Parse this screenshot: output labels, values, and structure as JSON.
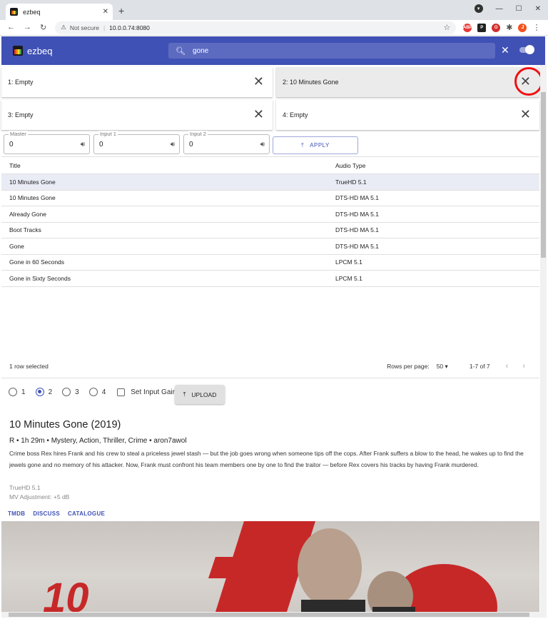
{
  "browser": {
    "tab_title": "ezbeq",
    "security": "Not secure",
    "url": "10.0.0.74:8080",
    "profile_initial": "J"
  },
  "app": {
    "title": "ezbeq",
    "search_value": "gone"
  },
  "slots": [
    {
      "label": "1: Empty",
      "active": false
    },
    {
      "label": "2: 10 Minutes Gone",
      "active": true
    },
    {
      "label": "3: Empty",
      "active": false
    },
    {
      "label": "4: Empty",
      "active": false
    }
  ],
  "gains": [
    {
      "label": "Master",
      "value": "0"
    },
    {
      "label": "Input 1",
      "value": "0"
    },
    {
      "label": "Input 2",
      "value": "0"
    }
  ],
  "apply_label": "APPLY",
  "table": {
    "columns": [
      "Title",
      "Audio Type"
    ],
    "rows": [
      [
        "10 Minutes Gone",
        "TrueHD 5.1"
      ],
      [
        "10 Minutes Gone",
        "DTS-HD MA 5.1"
      ],
      [
        "Already Gone",
        "DTS-HD MA 5.1"
      ],
      [
        "Boot Tracks",
        "DTS-HD MA 5.1"
      ],
      [
        "Gone",
        "DTS-HD MA 5.1"
      ],
      [
        "Gone in 60 Seconds",
        "LPCM 5.1"
      ],
      [
        "Gone in Sixty Seconds",
        "LPCM 5.1"
      ]
    ],
    "selected_text": "1 row selected",
    "rows_per_page_label": "Rows per page:",
    "rows_per_page_value": "50",
    "range": "1-7 of 7"
  },
  "device_slots": [
    "1",
    "2",
    "3",
    "4"
  ],
  "selected_device_slot": "2",
  "set_input_gain_label": "Set Input Gain",
  "upload_label": "UPLOAD",
  "details": {
    "title": "10 Minutes Gone (2019)",
    "meta": "R • 1h 29m • Mystery, Action, Thriller, Crime • aron7awol",
    "description": "Crime boss Rex hires Frank and his crew to steal a priceless jewel stash — but the job goes wrong when someone tips off the cops. After Frank suffers a blow to the head, he wakes up to find the jewels gone and no memory of his attacker. Now, Frank must confront his team members one by one to find the traitor — before Rex covers his tracks by having Frank murdered.",
    "audio": "TrueHD 5.1",
    "mv_adjustment": "MV Adjustment: +5 dB",
    "links": [
      "TMDB",
      "DISCUSS",
      "CATALOGUE"
    ]
  },
  "poster_text": "10"
}
